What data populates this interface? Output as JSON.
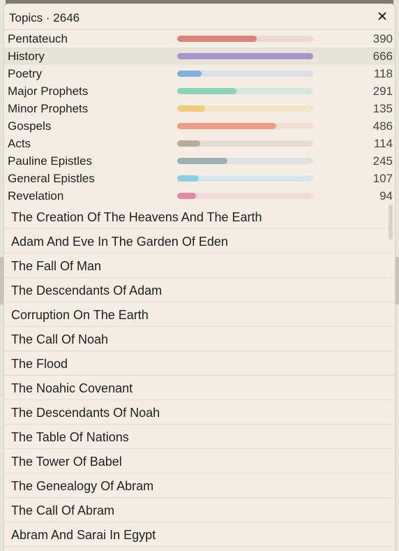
{
  "title": "Topics · 2646",
  "books": [
    {
      "name": "Pentateuch",
      "count": "390",
      "fraction": 0.585,
      "color": "#d8867b",
      "track": "#efd8d2"
    },
    {
      "name": "History",
      "count": "666",
      "fraction": 1.0,
      "color": "#a995c9",
      "track": "#e4ddea",
      "selected": true
    },
    {
      "name": "Poetry",
      "count": "118",
      "fraction": 0.18,
      "color": "#84b0dd",
      "track": "#d9e1e6"
    },
    {
      "name": "Major Prophets",
      "count": "291",
      "fraction": 0.437,
      "color": "#91d1b9",
      "track": "#d8e7de"
    },
    {
      "name": "Minor Prophets",
      "count": "135",
      "fraction": 0.203,
      "color": "#f0cc7e",
      "track": "#f4e5c9"
    },
    {
      "name": "Gospels",
      "count": "486",
      "fraction": 0.73,
      "color": "#ea9e85",
      "track": "#f2ddd3"
    },
    {
      "name": "Acts",
      "count": "114",
      "fraction": 0.171,
      "color": "#b9aa9c",
      "track": "#e5ddd4"
    },
    {
      "name": "Pauline Epistles",
      "count": "245",
      "fraction": 0.368,
      "color": "#9fafb6",
      "track": "#dfe2e0"
    },
    {
      "name": "General Epistles",
      "count": "107",
      "fraction": 0.161,
      "color": "#8fcde0",
      "track": "#d9e6e7"
    },
    {
      "name": "Revelation",
      "count": "94",
      "fraction": 0.141,
      "color": "#e08aaa",
      "track": "#f0d9da"
    }
  ],
  "topics": [
    "The Creation Of The Heavens And The Earth",
    "Adam And Eve In The Garden Of Eden",
    "The Fall Of Man",
    "The Descendants Of Adam",
    "Corruption On The Earth",
    "The Call Of Noah",
    "The Flood",
    "The Noahic Covenant",
    "The Descendants Of Noah",
    "The Table Of Nations",
    "The Tower Of Babel",
    "The Genealogy Of Abram",
    "The Call Of Abram",
    "Abram And Sarai In Egypt"
  ]
}
